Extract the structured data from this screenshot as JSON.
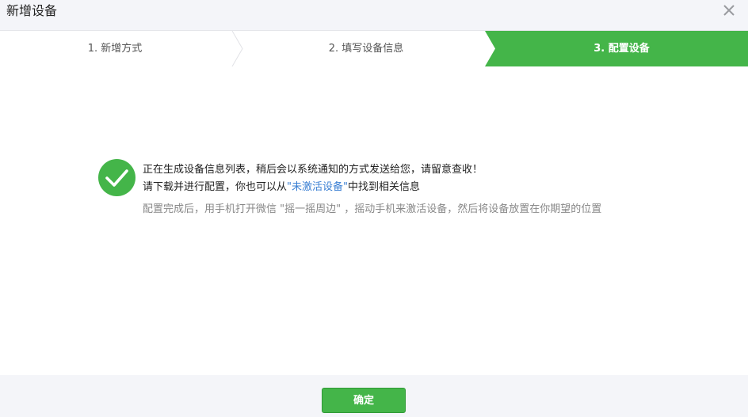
{
  "dialog": {
    "title": "新增设备"
  },
  "steps": [
    {
      "label": "1. 新增方式",
      "active": false
    },
    {
      "label": "2. 填写设备信息",
      "active": false
    },
    {
      "label": "3. 配置设备",
      "active": true
    }
  ],
  "message": {
    "line1": "正在生成设备信息列表，稍后会以系统通知的方式发送给您，请留意查收！",
    "line2_prefix": "请下载并进行配置，你也可以从",
    "line2_link": "\"未激活设备\"",
    "line2_suffix": "中找到相关信息",
    "line3": "配置完成后，用手机打开微信 \"摇一摇周边\" ，摇动手机来激活设备，然后将设备放置在你期望的位置"
  },
  "footer": {
    "confirm_label": "确定"
  },
  "colors": {
    "accent_green": "#44b549",
    "link_blue": "#3a7fd3",
    "header_bg": "#f4f5f9"
  },
  "icons": {
    "close": "close-icon",
    "success": "check-circle-icon"
  }
}
